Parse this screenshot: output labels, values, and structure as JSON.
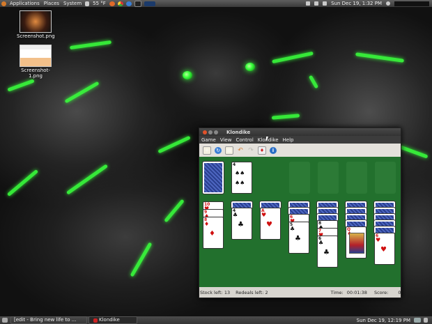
{
  "top_panel": {
    "menus": [
      "Applications",
      "Places",
      "System"
    ],
    "weather": "55 °F",
    "datetime": "Sun Dec 19,  1:32 PM"
  },
  "desktop": {
    "icons": [
      {
        "label": "Screenshot.png"
      },
      {
        "label": "Screenshot-1.png"
      }
    ]
  },
  "window": {
    "title": "Klondike",
    "menus": [
      "Game",
      "View",
      "Control",
      "Klondike",
      "Help"
    ],
    "toolbar": [
      "new-game-icon",
      "restart-icon",
      "select-game-icon",
      "undo-icon",
      "redo-icon",
      "hint-icon",
      "info-icon"
    ],
    "status": {
      "stock_left": "Stock left: 13",
      "redeals_left": "Redeals left: 2",
      "time_label": "Time:",
      "time_value": "00:01:38",
      "score_label": "Score:",
      "score_value": "0"
    },
    "colors": {
      "felt": "#22702d",
      "card_back": "#2a3f8f",
      "red_suit": "#d01010"
    },
    "waste_top": {
      "rank": "4",
      "suit": "♠",
      "color": "black"
    },
    "tableau": [
      {
        "hidden": 0,
        "visible": [
          {
            "rank": "10",
            "suit": "♥"
          },
          {
            "rank": "9",
            "suit": "♦"
          },
          {
            "rank": "8",
            "suit": "♦"
          }
        ]
      },
      {
        "hidden": 1,
        "visible": [
          {
            "rank": "4",
            "suit": "♣"
          }
        ]
      },
      {
        "hidden": 1,
        "visible": [
          {
            "rank": "A",
            "suit": "♥"
          }
        ]
      },
      {
        "hidden": 2,
        "visible": [
          {
            "rank": "6",
            "suit": "♥"
          },
          {
            "rank": "5",
            "suit": "♣"
          }
        ]
      },
      {
        "hidden": 3,
        "visible": [
          {
            "rank": "8",
            "suit": "♠"
          },
          {
            "rank": "7",
            "suit": "♥"
          },
          {
            "rank": "6",
            "suit": "♣"
          }
        ]
      },
      {
        "hidden": 4,
        "visible": [
          {
            "rank": "Q",
            "suit": "♦"
          }
        ]
      },
      {
        "hidden": 5,
        "visible": [
          {
            "rank": "6",
            "suit": "♥"
          }
        ]
      }
    ]
  },
  "bottom_panel": {
    "tasks": [
      {
        "label": "[edit - Bring new life to ..."
      },
      {
        "label": "Klondike"
      }
    ],
    "datetime": "Sun Dec 19, 12:19 PM"
  }
}
